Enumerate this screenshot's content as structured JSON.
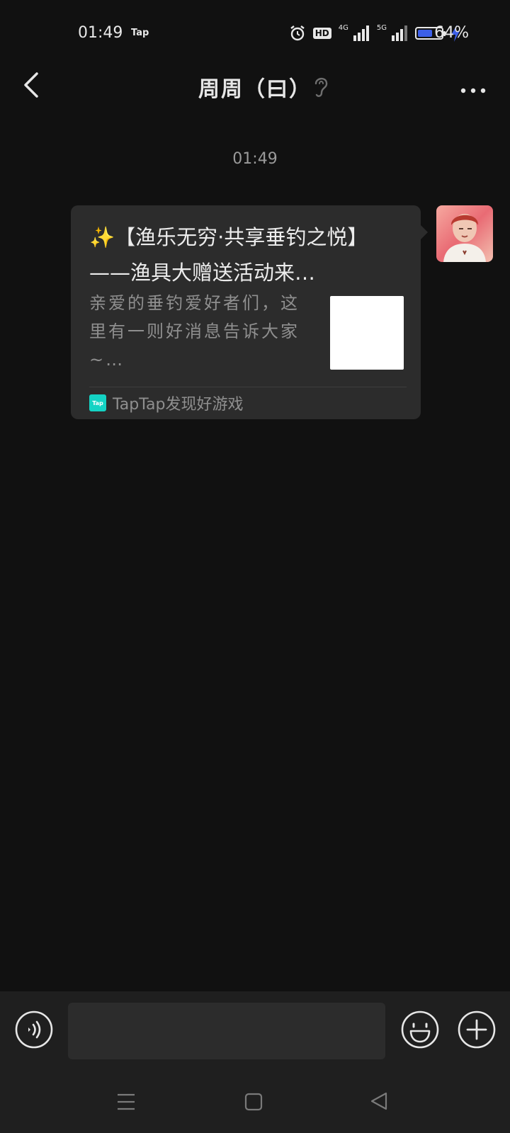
{
  "status_bar": {
    "time": "01:49",
    "app_label": "Tap",
    "hd_label": "HD",
    "network_1": "4G",
    "network_2": "5G",
    "battery_percent_text": "64%",
    "battery_level": 0.64,
    "battery_color": "#3c5fe8",
    "icons": [
      "alarm-icon",
      "hd-icon",
      "signal-icon",
      "signal-icon",
      "battery-icon",
      "charging-icon"
    ]
  },
  "header": {
    "title": "周周（曰）",
    "back_icon": "chevron-left-icon",
    "ear_icon": "ear-icon",
    "more_icon": "more-horizontal-icon"
  },
  "chat": {
    "timestamp": "01:49",
    "message": {
      "title": "✨【渔乐无穷·共享垂钓之悦】——渔具大赠送活动来…",
      "description": "亲爱的垂钓爱好者们，这里有一则好消息告诉大家~…",
      "footer_logo": "Tap",
      "footer_text": "TapTap发现好游戏",
      "logo_color": "#14d3c4"
    }
  },
  "input_bar": {
    "voice_icon": "voice-icon",
    "emoji_icon": "emoji-icon",
    "plus_icon": "plus-icon"
  },
  "nav_bar": {
    "icons": [
      "menu-icon",
      "home-icon",
      "back-triangle-icon"
    ]
  }
}
